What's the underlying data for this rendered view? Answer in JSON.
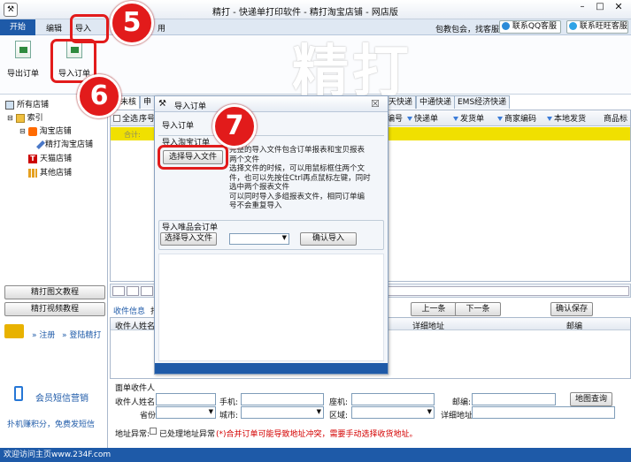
{
  "window": {
    "title": "精打 - 快递单打印软件 - 精打淘宝店铺 - 网店版",
    "slogan": "包教包会，找客服",
    "qq_service": "联系QQ客服",
    "wangwang_service": "联系旺旺客服",
    "watermark": "精打"
  },
  "menu": {
    "start": "开始",
    "edit": "编辑",
    "import": "导入",
    "hidden_tab": "用"
  },
  "toolbar": {
    "export_orders": "导出订单",
    "import_orders": "导入订单"
  },
  "sidebar": {
    "root": "所有店铺",
    "index": "索引",
    "taobao_store": "淘宝店铺",
    "jingda_taobao_store": "精打淘宝店铺",
    "tmall_store": "天猫店铺",
    "other_store": "其他店铺",
    "graphic_tutorial": "精打图文教程",
    "video_tutorial": "精打视频教程",
    "register": "注册",
    "login": "登陆精打",
    "sms_marketing": "会员短信营销",
    "sms_promo": "扑机赚积分，免费发短信"
  },
  "tabs": [
    "未核",
    "申",
    "天快递",
    "中通快递",
    "EMS经济快递"
  ],
  "table": {
    "select_all": "全选",
    "seq": "序号",
    "row_label": "合计:",
    "columns": [
      "编号",
      "快递单",
      "发货单",
      "商家编码",
      "本地发货",
      "商品标"
    ]
  },
  "dialog": {
    "title": "导入订单",
    "close": "☒",
    "section_import": "导入订单",
    "section_taobao": "导入淘宝订单",
    "select_file_btn": "选择导入文件",
    "help_lines": [
      "完整的导入文件包含订单报表和宝贝报表",
      "两个文件",
      "选择文件的时候，可以用鼠标框住两个文",
      "件，也可以先按住Ctrl再点鼠标左键，同时",
      "选中两个报表文件",
      "可以同时导入多组报表文件，相同订单编",
      "号不会重复导入"
    ],
    "section_vip": "导入唯品会订单",
    "vip_select_btn": "选择导入文件",
    "vip_confirm_btn": "确认导入"
  },
  "details": {
    "tab_receiver": "收件信息",
    "tab_other": "打",
    "prev_btn": "上一条",
    "next_btn": "下一条",
    "confirm_save_btn": "确认保存",
    "col_receiver_name": "收件人姓名",
    "col_address": "详细地址",
    "col_postcode": "邮编"
  },
  "form": {
    "section": "面单收件人",
    "name_label": "收件人姓名:",
    "phone_label": "手机:",
    "landline_label": "座机:",
    "postcode_label": "邮编:",
    "map_btn": "地图查询",
    "province_label": "省份:",
    "city_label": "城市:",
    "district_label": "区域:",
    "address_label": "详细地址:",
    "abnormal_label": "地址异常:",
    "processed_label": "已处理地址异常",
    "warning": "(*)合并订单可能导致地址冲突，需要手动选择收货地址。"
  },
  "statusbar": {
    "text": "欢迎访问主页www.234F.com"
  },
  "annotations": [
    "5",
    "6",
    "7"
  ],
  "colors": {
    "accent_blue": "#1e5aa8",
    "highlight_row": "#f0e000",
    "annotation_red": "#e21b1b"
  }
}
